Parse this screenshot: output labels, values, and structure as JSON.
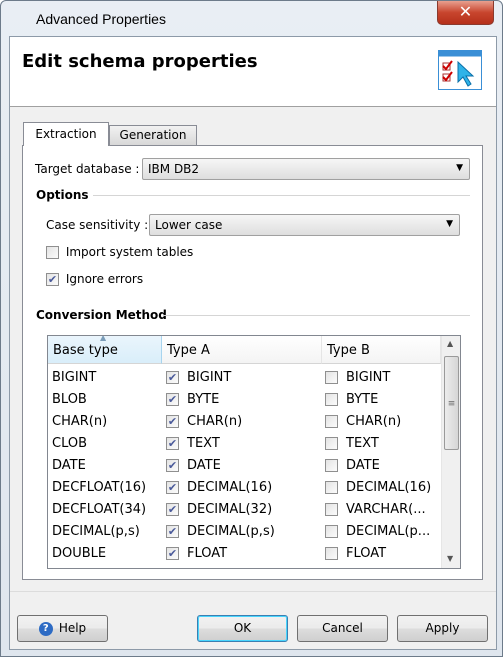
{
  "window": {
    "title": "Advanced Properties",
    "close_label": "✕"
  },
  "header": {
    "title": "Edit schema properties",
    "icon": "checklist-cursor-icon"
  },
  "tabs": [
    {
      "label": "Extraction",
      "active": true
    },
    {
      "label": "Generation",
      "active": false
    }
  ],
  "extraction": {
    "target_db_label": "Target database :",
    "target_db_value": "IBM DB2",
    "options_title": "Options",
    "case_label": "Case sensitivity :",
    "case_value": "Lower case",
    "import_system_tables": {
      "label": "Import system tables",
      "checked": false
    },
    "ignore_errors": {
      "label": "Ignore errors",
      "checked": true
    },
    "conversion_title": "Conversion Method",
    "columns": [
      "Base type",
      "Type A",
      "Type B"
    ],
    "rows": [
      {
        "base": "BIGINT",
        "a": "BIGINT",
        "a_checked": true,
        "b": "BIGINT",
        "b_checked": false
      },
      {
        "base": "BLOB",
        "a": "BYTE",
        "a_checked": true,
        "b": "BYTE",
        "b_checked": false
      },
      {
        "base": "CHAR(n)",
        "a": "CHAR(n)",
        "a_checked": true,
        "b": "CHAR(n)",
        "b_checked": false
      },
      {
        "base": "CLOB",
        "a": "TEXT",
        "a_checked": true,
        "b": "TEXT",
        "b_checked": false
      },
      {
        "base": "DATE",
        "a": "DATE",
        "a_checked": true,
        "b": "DATE",
        "b_checked": false
      },
      {
        "base": "DECFLOAT(16)",
        "a": "DECIMAL(16)",
        "a_checked": true,
        "b": "DECIMAL(16)",
        "b_checked": false
      },
      {
        "base": "DECFLOAT(34)",
        "a": "DECIMAL(32)",
        "a_checked": true,
        "b": "VARCHAR(...",
        "b_checked": false
      },
      {
        "base": "DECIMAL(p,s)",
        "a": "DECIMAL(p,s)",
        "a_checked": true,
        "b": "DECIMAL(p...",
        "b_checked": false
      },
      {
        "base": "DOUBLE",
        "a": "FLOAT",
        "a_checked": true,
        "b": "FLOAT",
        "b_checked": false
      }
    ]
  },
  "footer": {
    "help": "Help",
    "ok": "OK",
    "cancel": "Cancel",
    "apply": "Apply"
  }
}
